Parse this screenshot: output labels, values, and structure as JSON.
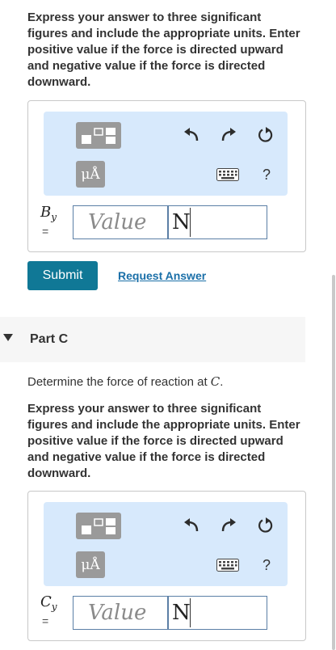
{
  "part_b": {
    "instructions": "Express your answer to three significant figures and include the appropriate units. Enter positive value if the force is directed upward and negative value if the force is directed downward.",
    "variable": "B",
    "variable_sub": "y",
    "equals": "=",
    "value_placeholder": "Value",
    "units_value": "N"
  },
  "toolbar": {
    "unit_symbol": "μÅ",
    "help_symbol": "?"
  },
  "actions": {
    "submit_label": "Submit",
    "request_answer_label": "Request Answer"
  },
  "part_c": {
    "title": "Part C",
    "prompt_text": "Determine the force of reaction at ",
    "prompt_var": "C",
    "prompt_end": ".",
    "instructions": "Express your answer to three significant figures and include the appropriate units. Enter positive value if the force is directed upward and negative value if the force is directed downward.",
    "variable": "C",
    "variable_sub": "y",
    "equals": "=",
    "value_placeholder": "Value",
    "units_value": "N"
  },
  "colors": {
    "submit_bg": "#107896",
    "toolbar_bg": "#d7e9fc",
    "link": "#1a6fa8"
  }
}
